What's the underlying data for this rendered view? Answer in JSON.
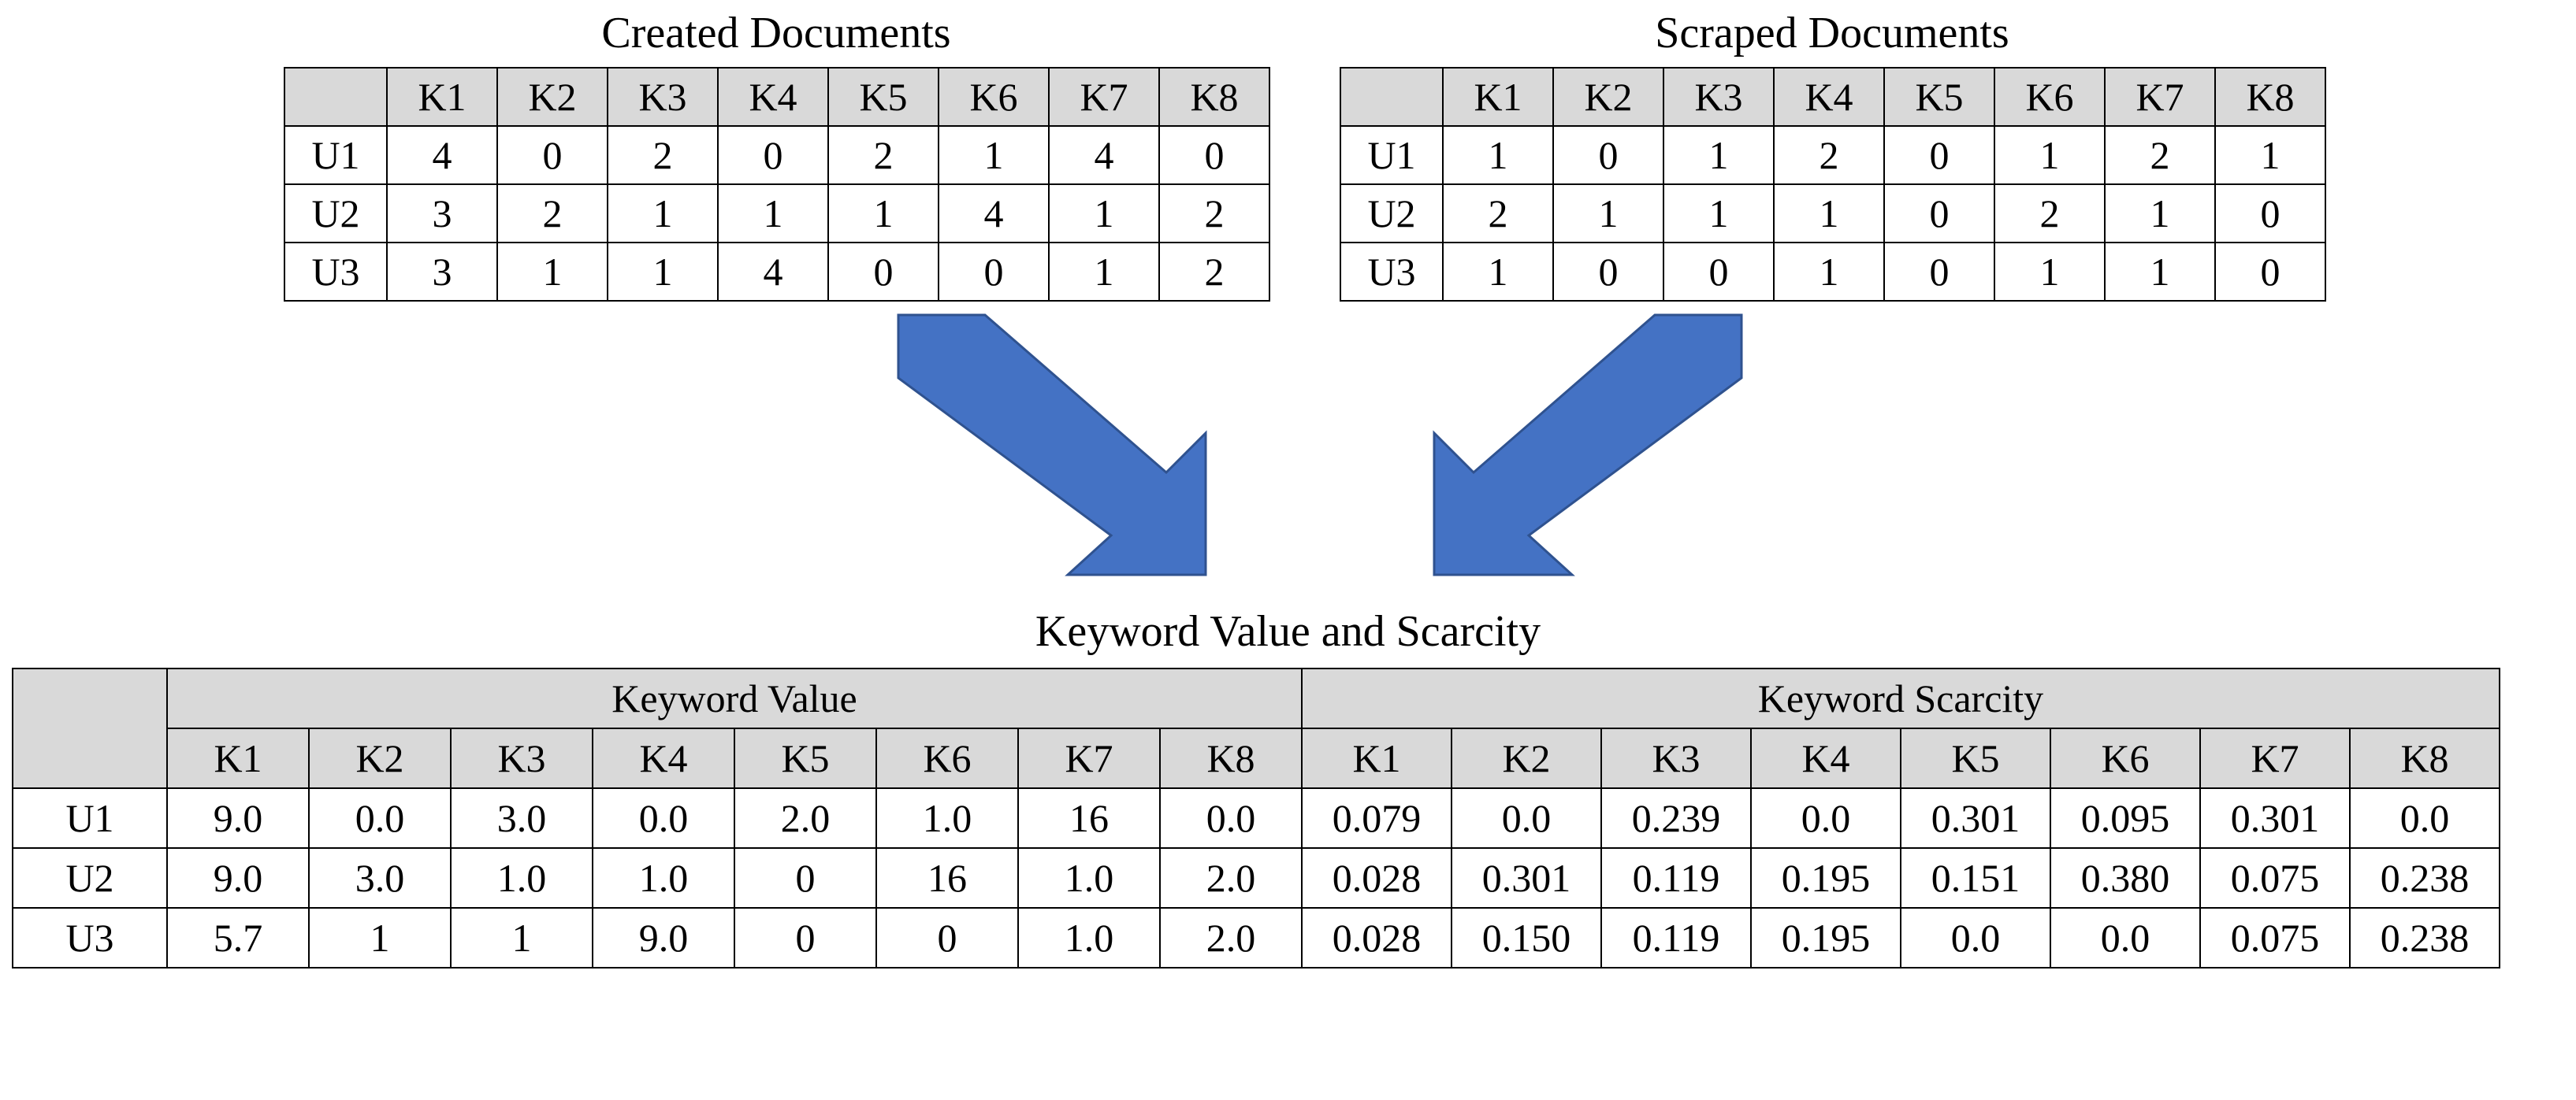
{
  "titles": {
    "created": "Created Documents",
    "scraped": "Scraped Documents",
    "combined": "Keyword Value and Scarcity"
  },
  "keywords": [
    "K1",
    "K2",
    "K3",
    "K4",
    "K5",
    "K6",
    "K7",
    "K8"
  ],
  "users": [
    "U1",
    "U2",
    "U3"
  ],
  "created": {
    "U1": [
      "4",
      "0",
      "2",
      "0",
      "2",
      "1",
      "4",
      "0"
    ],
    "U2": [
      "3",
      "2",
      "1",
      "1",
      "1",
      "4",
      "1",
      "2"
    ],
    "U3": [
      "3",
      "1",
      "1",
      "4",
      "0",
      "0",
      "1",
      "2"
    ]
  },
  "scraped": {
    "U1": [
      "1",
      "0",
      "1",
      "2",
      "0",
      "1",
      "2",
      "1"
    ],
    "U2": [
      "2",
      "1",
      "1",
      "1",
      "0",
      "2",
      "1",
      "0"
    ],
    "U3": [
      "1",
      "0",
      "0",
      "1",
      "0",
      "1",
      "1",
      "0"
    ]
  },
  "group_headers": {
    "value": "Keyword Value",
    "scarcity": "Keyword Scarcity"
  },
  "value": {
    "U1": [
      "9.0",
      "0.0",
      "3.0",
      "0.0",
      "2.0",
      "1.0",
      "16",
      "0.0"
    ],
    "U2": [
      "9.0",
      "3.0",
      "1.0",
      "1.0",
      "0",
      "16",
      "1.0",
      "2.0"
    ],
    "U3": [
      "5.7",
      "1",
      "1",
      "9.0",
      "0",
      "0",
      "1.0",
      "2.0"
    ]
  },
  "scarcity": {
    "U1": [
      "0.079",
      "0.0",
      "0.239",
      "0.0",
      "0.301",
      "0.095",
      "0.301",
      "0.0"
    ],
    "U2": [
      "0.028",
      "0.301",
      "0.119",
      "0.195",
      "0.151",
      "0.380",
      "0.075",
      "0.238"
    ],
    "U3": [
      "0.028",
      "0.150",
      "0.119",
      "0.195",
      "0.0",
      "0.0",
      "0.075",
      "0.238"
    ]
  },
  "chart_data": [
    {
      "type": "table",
      "title": "Created Documents",
      "columns": [
        "K1",
        "K2",
        "K3",
        "K4",
        "K5",
        "K6",
        "K7",
        "K8"
      ],
      "rows": [
        "U1",
        "U2",
        "U3"
      ],
      "values": [
        [
          4,
          0,
          2,
          0,
          2,
          1,
          4,
          0
        ],
        [
          3,
          2,
          1,
          1,
          1,
          4,
          1,
          2
        ],
        [
          3,
          1,
          1,
          4,
          0,
          0,
          1,
          2
        ]
      ]
    },
    {
      "type": "table",
      "title": "Scraped Documents",
      "columns": [
        "K1",
        "K2",
        "K3",
        "K4",
        "K5",
        "K6",
        "K7",
        "K8"
      ],
      "rows": [
        "U1",
        "U2",
        "U3"
      ],
      "values": [
        [
          1,
          0,
          1,
          2,
          0,
          1,
          2,
          1
        ],
        [
          2,
          1,
          1,
          1,
          0,
          2,
          1,
          0
        ],
        [
          1,
          0,
          0,
          1,
          0,
          1,
          1,
          0
        ]
      ]
    },
    {
      "type": "table",
      "title": "Keyword Value",
      "columns": [
        "K1",
        "K2",
        "K3",
        "K4",
        "K5",
        "K6",
        "K7",
        "K8"
      ],
      "rows": [
        "U1",
        "U2",
        "U3"
      ],
      "values": [
        [
          9.0,
          0.0,
          3.0,
          0.0,
          2.0,
          1.0,
          16,
          0.0
        ],
        [
          9.0,
          3.0,
          1.0,
          1.0,
          0,
          16,
          1.0,
          2.0
        ],
        [
          5.7,
          1,
          1,
          9.0,
          0,
          0,
          1.0,
          2.0
        ]
      ]
    },
    {
      "type": "table",
      "title": "Keyword Scarcity",
      "columns": [
        "K1",
        "K2",
        "K3",
        "K4",
        "K5",
        "K6",
        "K7",
        "K8"
      ],
      "rows": [
        "U1",
        "U2",
        "U3"
      ],
      "values": [
        [
          0.079,
          0.0,
          0.239,
          0.0,
          0.301,
          0.095,
          0.301,
          0.0
        ],
        [
          0.028,
          0.301,
          0.119,
          0.195,
          0.151,
          0.38,
          0.075,
          0.238
        ],
        [
          0.028,
          0.15,
          0.119,
          0.195,
          0.0,
          0.0,
          0.075,
          0.238
        ]
      ]
    }
  ]
}
